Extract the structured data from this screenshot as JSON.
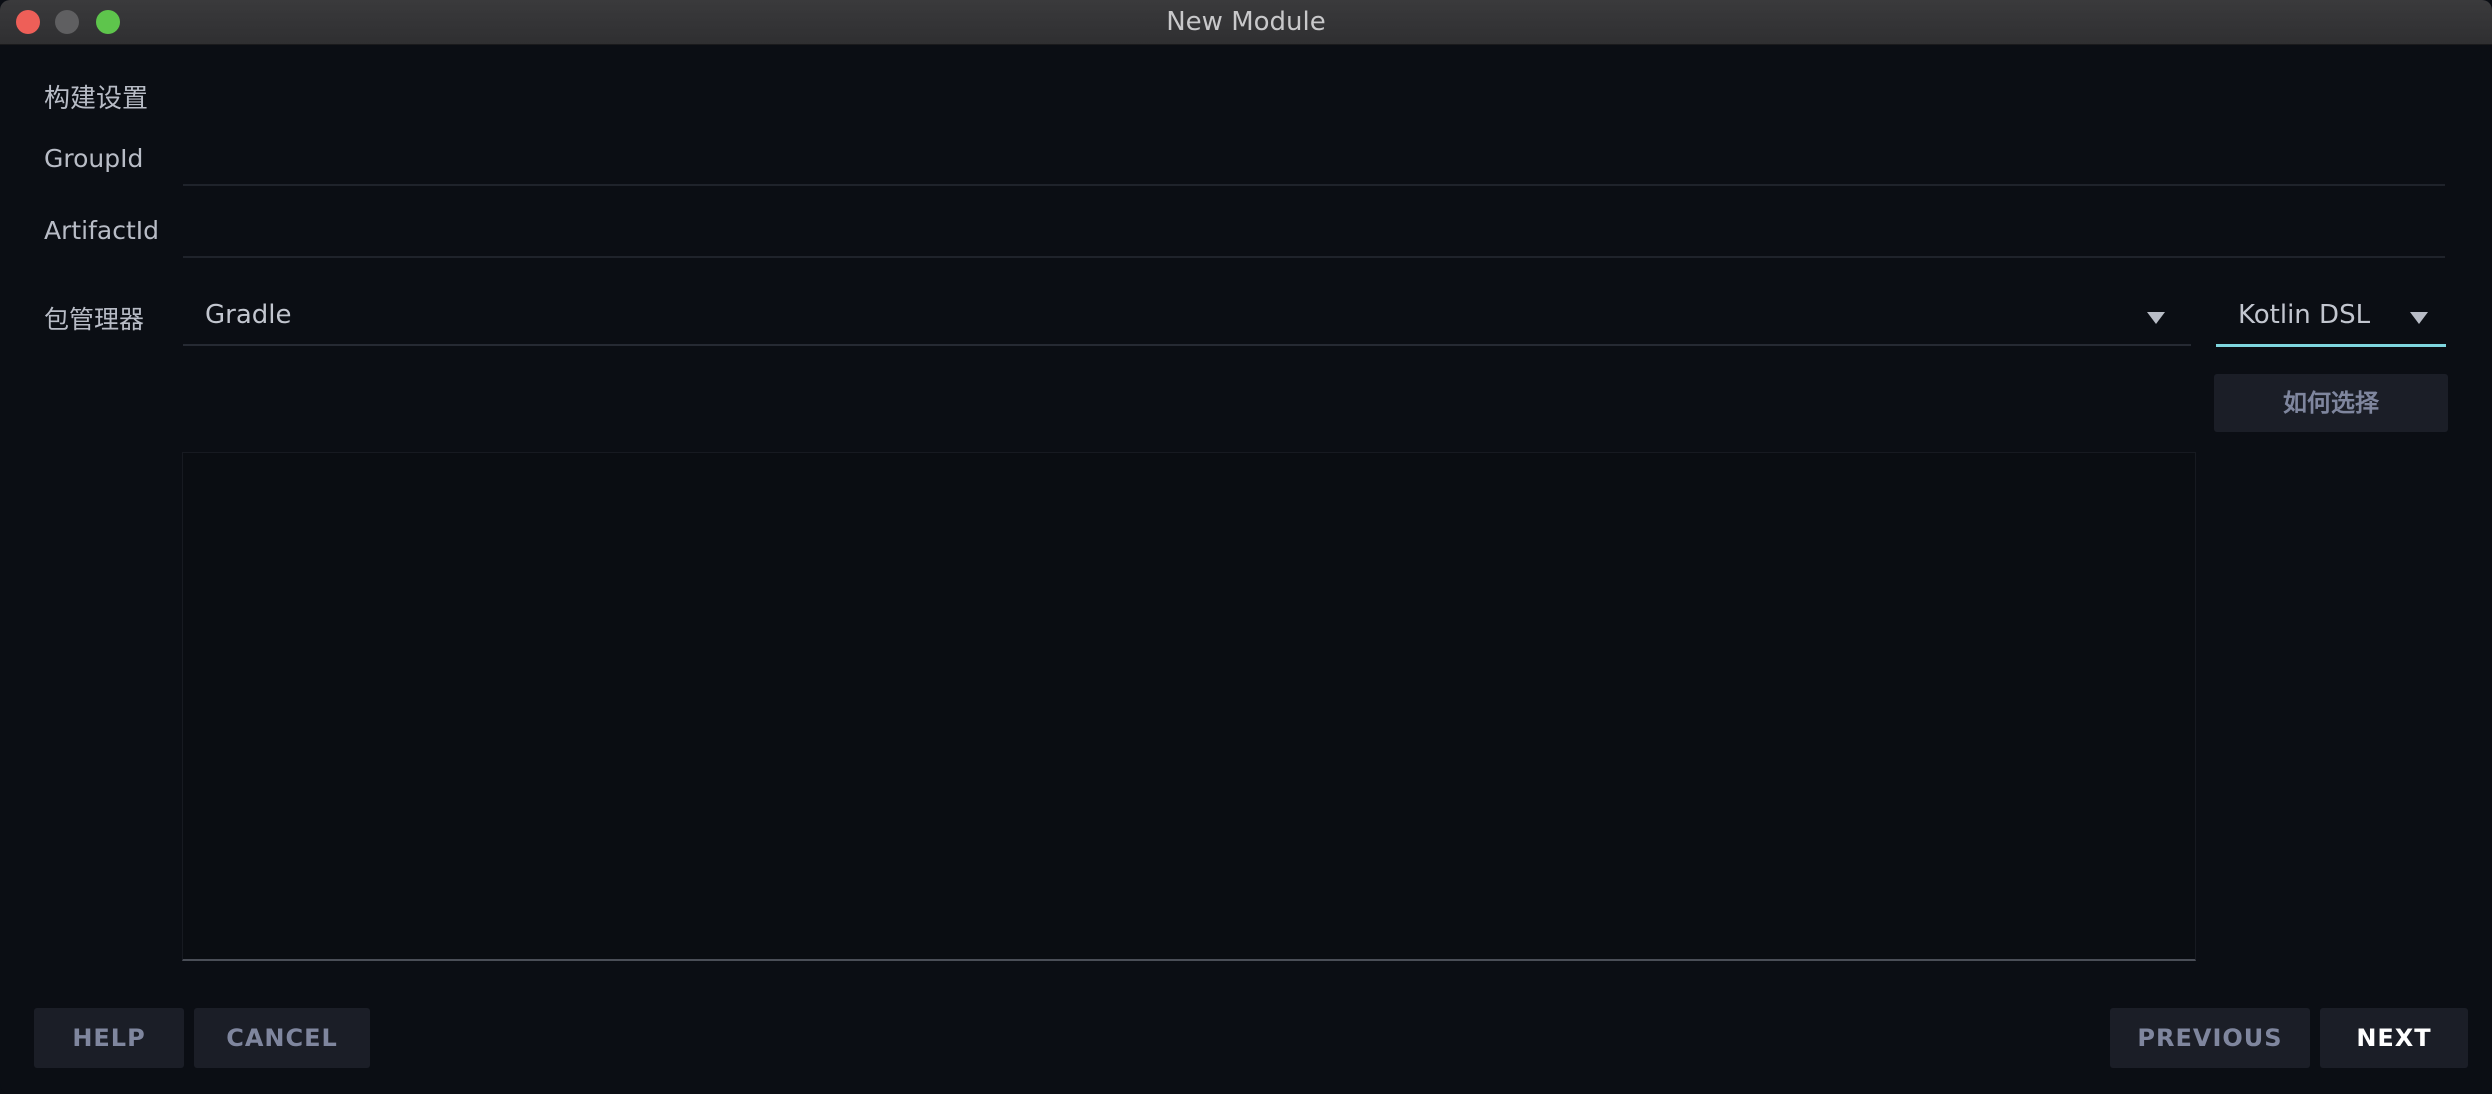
{
  "window": {
    "title": "New Module"
  },
  "form": {
    "section_title": "构建设置",
    "group_id": {
      "label": "GroupId",
      "value": ""
    },
    "artifact_id": {
      "label": "ArtifactId",
      "value": ""
    },
    "package_manager": {
      "label": "包管理器",
      "selected": "Gradle",
      "dsl_selected": "Kotlin DSL"
    },
    "how_to_choose": "如何选择",
    "description": ""
  },
  "footer": {
    "help": "HELP",
    "cancel": "CANCEL",
    "previous": "PREVIOUS",
    "next": "NEXT"
  },
  "colors": {
    "background": "#0b0e14",
    "accent": "#7fd6df",
    "muted_button_text": "#7f869e",
    "primary_button_text": "#ffffff"
  }
}
